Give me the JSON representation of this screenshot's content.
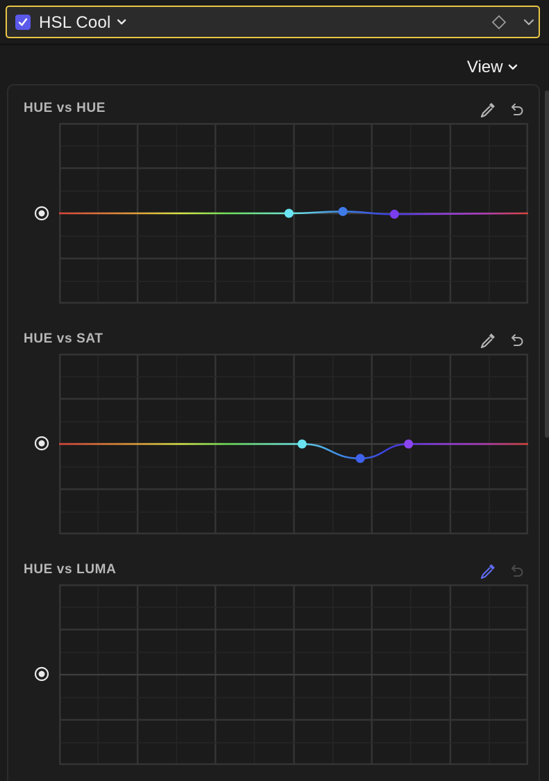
{
  "header": {
    "checked": true,
    "title": "HSL Cool",
    "icons": [
      "checkbox-check-icon",
      "chevron-down-icon",
      "keyframe-diamond-icon",
      "chevron-down-icon"
    ]
  },
  "view_button": {
    "label": "View"
  },
  "colors": {
    "accent": "#5b59ea",
    "selection_border": "#e9c645",
    "background": "#1b1b1b",
    "grid": "#333333",
    "cyan_point": "#6ae4f2",
    "blue_point": "#3f63ee",
    "purple_point": "#7a3df0"
  },
  "sections": [
    {
      "title": "HUE vs HUE",
      "eyedropper_active": false,
      "reset_enabled": true,
      "control_points": [
        {
          "hue": 0.49,
          "offset": 0.0,
          "color": "#6ae4f2"
        },
        {
          "hue": 0.605,
          "offset": 0.01,
          "color": "#3f7be8"
        },
        {
          "hue": 0.715,
          "offset": -0.005,
          "color": "#7a3df0"
        }
      ]
    },
    {
      "title": "HUE vs SAT",
      "eyedropper_active": false,
      "reset_enabled": true,
      "control_points": [
        {
          "hue": 0.518,
          "offset": 0.0,
          "color": "#6ae4f2"
        },
        {
          "hue": 0.642,
          "offset": -0.08,
          "color": "#3f63ee"
        },
        {
          "hue": 0.745,
          "offset": 0.0,
          "color": "#8a45f0"
        }
      ]
    },
    {
      "title": "HUE vs LUMA",
      "eyedropper_active": true,
      "reset_enabled": false,
      "control_points": []
    }
  ]
}
